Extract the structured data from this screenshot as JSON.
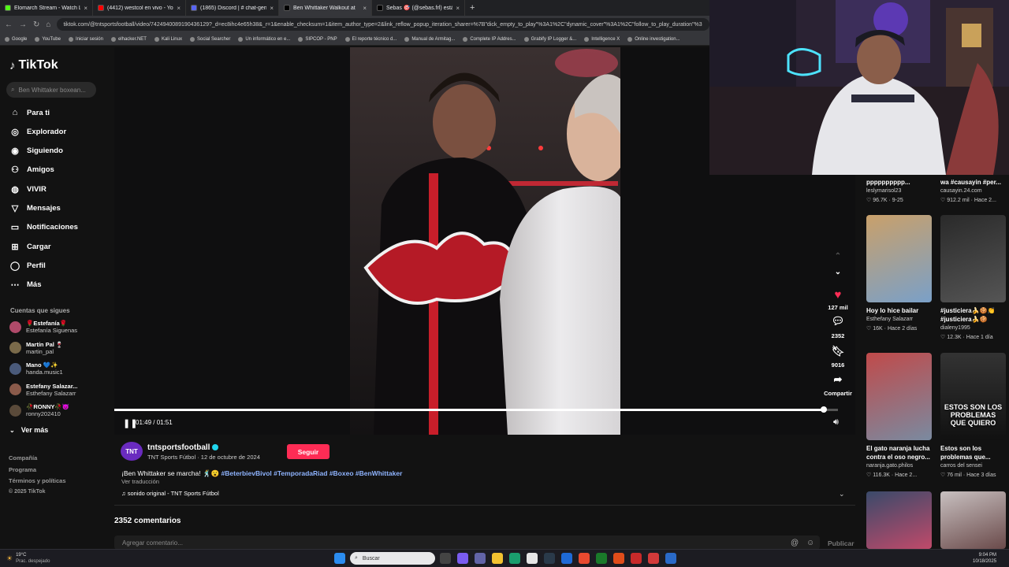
{
  "tabs": [
    {
      "title": "Elomarch Stream - Watch Live",
      "color": "#53fc18"
    },
    {
      "title": "(4412) westcol en vivo - YouTube",
      "color": "#ff0000"
    },
    {
      "title": "(1865) Discord | # chat-gene",
      "color": "#5865f2"
    },
    {
      "title": "Ben Whittaker Walkout at",
      "color": "#000000"
    },
    {
      "title": "Sebas 🎯 (@sebas.frl) está",
      "color": "#000000"
    }
  ],
  "url": "tiktok.com/@tntsportsfootball/video/7424940089190436129?_d=ec8ihc4e65h38&_r=1&enable_checksum=1&item_author_type=2&link_reflow_popup_iteration_sharer=%7B\"dick_empty_to_play\"%3A1%2C\"dynamic_cover\"%3A1%2C\"follow_to_play_duration\"%3",
  "bookmarks": [
    "Google",
    "YouTube",
    "Iniciar sesión",
    "elhacker.NET",
    "Kali Linux",
    "Social Searcher",
    "Un informático en e...",
    "SIPCOP - PNP",
    "El reporte técnico d...",
    "Manual de Armitag...",
    "Complete IP Addres...",
    "Grabify IP Logger &...",
    "Intelligence X",
    "Online investigation..."
  ],
  "sidebar": {
    "logo": "TikTok",
    "search_placeholder": "Ben Whittaker boxean...",
    "nav": [
      "Para ti",
      "Explorador",
      "Siguiendo",
      "Amigos",
      "VIVIR",
      "Mensajes",
      "Notificaciones",
      "Cargar",
      "Perfil",
      "Más"
    ],
    "following_title": "Cuentas que sigues",
    "accounts": [
      {
        "name": "🌹Estefanía🌹",
        "handle": "Estefanía Siguenas",
        "color": "#b04a6a"
      },
      {
        "name": "Martín Pal 🍷",
        "handle": "martin_pal",
        "color": "#7a6a4a"
      },
      {
        "name": "Mano 💙✨",
        "handle": "handa.music1",
        "color": "#4a5a7a"
      },
      {
        "name": "Estefany Salazar...",
        "handle": "Esthefany Salazarr",
        "color": "#8a5a4a"
      },
      {
        "name": "🥀RONNY🥀😈",
        "handle": "ronny202410",
        "color": "#5a4a3a"
      }
    ],
    "see_more": "Ver más",
    "footer": [
      "Compañía",
      "Programa",
      "Términos y políticas",
      "© 2025 TikTok"
    ]
  },
  "video": {
    "time": "01:49 / 01:51",
    "progress": 0.98,
    "likes": "127 mil",
    "comments": "2352",
    "saves": "9016",
    "share_label": "Compartir"
  },
  "post": {
    "creator": "tntsportsfootball",
    "avatar_text": "TNT",
    "subline": "TNT Sports Fútbol · 12 de octubre de 2024",
    "follow_label": "Seguir",
    "description_text": "¡Ben Whittaker se marcha! 🕺😮 ",
    "hashtags": "#BeterbievBivol #TemporadaRiad #Boxeo #BenWhittaker",
    "translate": "Ver traducción",
    "sound": "♫ sonido original - TNT Sports Fútbol",
    "comments_title": "2352 comentarios",
    "comment_placeholder": "Agregar comentario...",
    "publish": "Publicar"
  },
  "recommendations": [
    {
      "title": "pppppppppp...",
      "author": "leslymarisol23",
      "likes": "96.7K",
      "date": "9-25"
    },
    {
      "title": "wa #causayin #per...",
      "author": "causayin.24.com",
      "likes": "912.2 mil",
      "date": "Hace 2..."
    },
    {
      "title": "Hoy lo hice bailar",
      "author": "Esthefany Salazarr",
      "likes": "16K",
      "date": "Hace 2 días"
    },
    {
      "title": "#justiciera🍌🍪👏 #justiciera🍌🍪",
      "author": "dialeny1995",
      "likes": "12.3K",
      "date": "Hace 1 día"
    },
    {
      "title": "El gato naranja lucha contra el oso negro...",
      "author": "naranja.gato.philos",
      "likes": "116.3K",
      "date": "Hace 2..."
    },
    {
      "title": "Estos son los problemas que...",
      "author": "carros del sensei",
      "likes": "76 mil",
      "date": "Hace 3 días"
    }
  ],
  "rec_thumb_overlay": "ESTOS SON LOS PROBLEMAS QUE QUIERO",
  "taskbar": {
    "weather_temp": "19°C",
    "weather_desc": "Prac. despejado",
    "search": "Buscar",
    "time": "9:04 PM",
    "date": "10/18/2025"
  }
}
